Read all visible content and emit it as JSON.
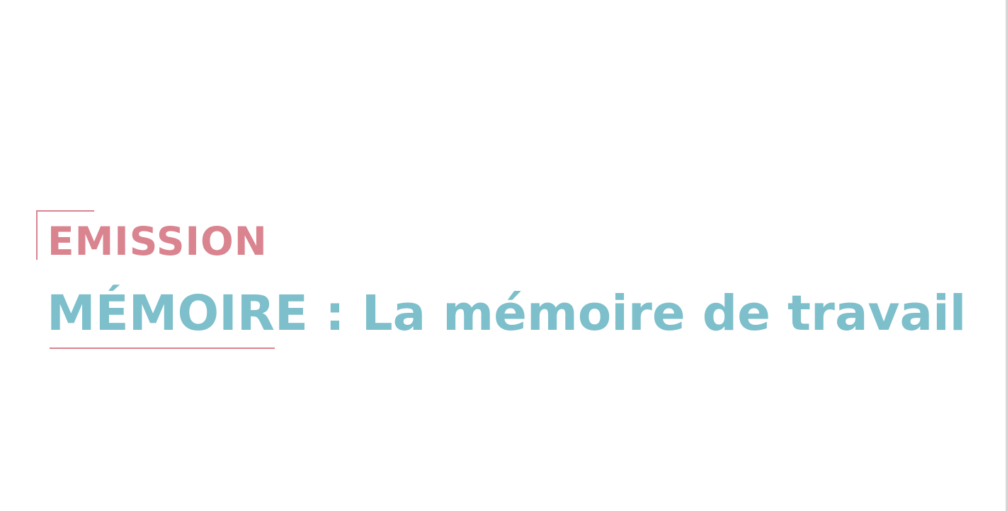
{
  "title_card": {
    "kicker": "EMISSION",
    "headline": "MÉMOIRE : La mémoire de travail"
  },
  "colors": {
    "accent_pink": "#d9848f",
    "accent_teal": "#7dbfcb",
    "background": "#ffffff"
  }
}
